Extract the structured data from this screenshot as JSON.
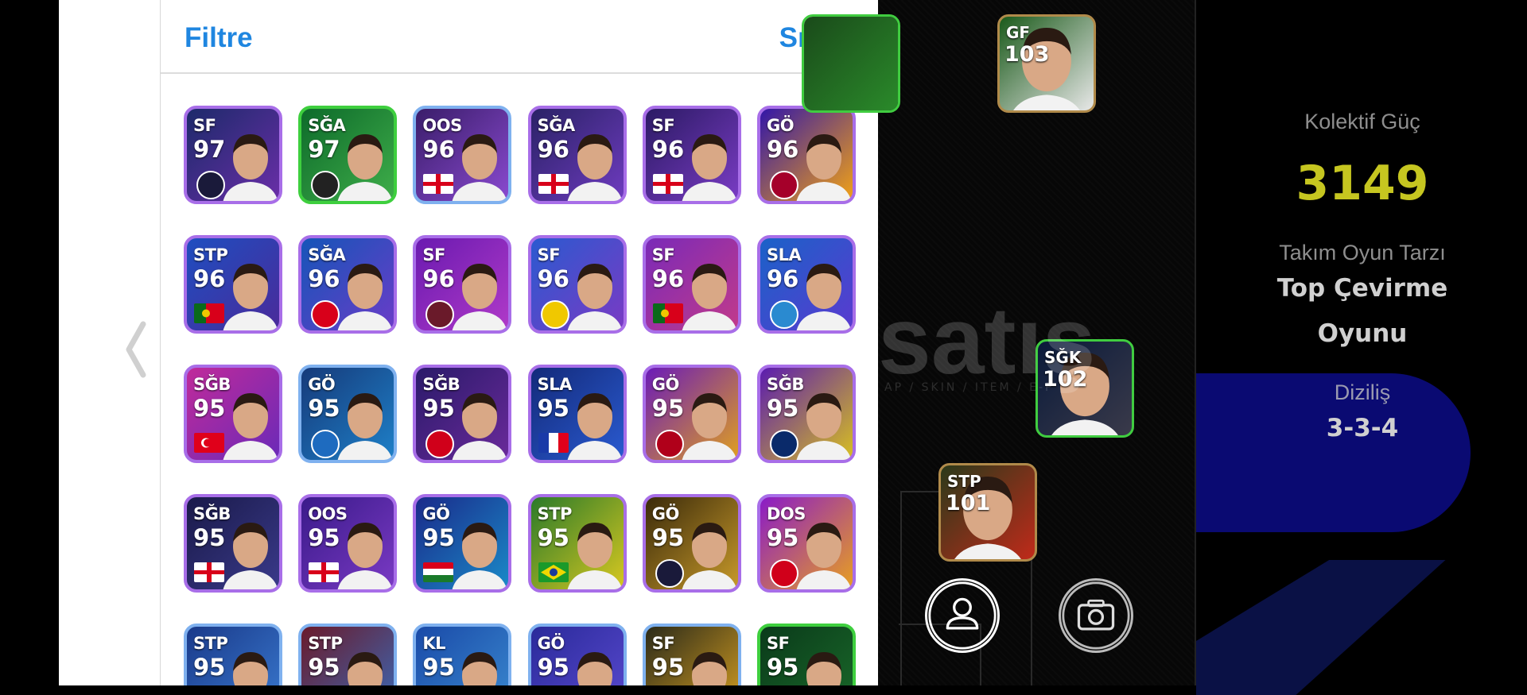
{
  "header": {
    "filter_label": "Filtre",
    "sort_label": "Sırala"
  },
  "colors": {
    "accent": "#1f86e0",
    "power": "#c6c620",
    "border_purple": "#a86ee8",
    "border_green": "#3ecf3e"
  },
  "players": [
    {
      "pos": "SF",
      "rating": "97",
      "mark": "badge",
      "badge_color": "#1a1a3a",
      "bg": [
        "#1c2a6a",
        "#6a2ea8"
      ],
      "border": "purple"
    },
    {
      "pos": "SĞA",
      "rating": "97",
      "mark": "badge",
      "badge_color": "#222",
      "bg": [
        "#0d6a2a",
        "#3fae4a"
      ],
      "border": "green"
    },
    {
      "pos": "OOS",
      "rating": "96",
      "mark": "flag",
      "flag": "eng",
      "bg": [
        "#3a1d6a",
        "#8a4ad0"
      ],
      "border": "blue"
    },
    {
      "pos": "SĞA",
      "rating": "96",
      "mark": "flag",
      "flag": "eng",
      "bg": [
        "#2a2266",
        "#6e3bbf"
      ],
      "border": "purple"
    },
    {
      "pos": "SF",
      "rating": "96",
      "mark": "flag",
      "flag": "eng",
      "bg": [
        "#2b1a64",
        "#7a3cc4"
      ],
      "border": "purple"
    },
    {
      "pos": "GÖ",
      "rating": "96",
      "mark": "badge",
      "badge_color": "#a5002a",
      "bg": [
        "#3216a8",
        "#f2a216"
      ],
      "border": "purple"
    },
    {
      "pos": "STP",
      "rating": "96",
      "mark": "flag",
      "flag": "por",
      "bg": [
        "#1e4ec0",
        "#4a2a9a"
      ],
      "border": "purple"
    },
    {
      "pos": "SĞA",
      "rating": "96",
      "mark": "badge",
      "badge_color": "#d8001a",
      "bg": [
        "#1555b8",
        "#6a3cc8"
      ],
      "border": "purple"
    },
    {
      "pos": "SF",
      "rating": "96",
      "mark": "badge",
      "badge_color": "#6a1a2a",
      "bg": [
        "#6a1ab0",
        "#b03ac8"
      ],
      "border": "purple"
    },
    {
      "pos": "SF",
      "rating": "96",
      "mark": "badge",
      "badge_color": "#f0c800",
      "bg": [
        "#2a5ad0",
        "#7a3ac4"
      ],
      "border": "purple"
    },
    {
      "pos": "SF",
      "rating": "96",
      "mark": "flag",
      "flag": "por",
      "bg": [
        "#7a2ab8",
        "#c23a8a"
      ],
      "border": "purple"
    },
    {
      "pos": "SLA",
      "rating": "96",
      "mark": "badge",
      "badge_color": "#2a8ad0",
      "bg": [
        "#1a62c8",
        "#5a3ad0"
      ],
      "border": "purple"
    },
    {
      "pos": "SĞB",
      "rating": "95",
      "mark": "flag",
      "flag": "tur",
      "bg": [
        "#c02a9a",
        "#6a2ab8"
      ],
      "border": "purple"
    },
    {
      "pos": "GÖ",
      "rating": "95",
      "mark": "badge",
      "badge_color": "#1e6bbf",
      "bg": [
        "#163a7a",
        "#1e80c8"
      ],
      "border": "blue"
    },
    {
      "pos": "SĞB",
      "rating": "95",
      "mark": "badge",
      "badge_color": "#d0001a",
      "bg": [
        "#2a1a6a",
        "#6a2a9a"
      ],
      "border": "purple"
    },
    {
      "pos": "SLA",
      "rating": "95",
      "mark": "flag",
      "flag": "fra",
      "bg": [
        "#132a7a",
        "#2a5ad0"
      ],
      "border": "purple"
    },
    {
      "pos": "GÖ",
      "rating": "95",
      "mark": "badge",
      "badge_color": "#b0001a",
      "bg": [
        "#6a1ab8",
        "#e0a020"
      ],
      "border": "purple"
    },
    {
      "pos": "SĞB",
      "rating": "95",
      "mark": "badge",
      "badge_color": "#0a2a6a",
      "bg": [
        "#5a1ab0",
        "#d8c020"
      ],
      "border": "purple"
    },
    {
      "pos": "SĞB",
      "rating": "95",
      "mark": "flag",
      "flag": "eng",
      "bg": [
        "#1a1a4a",
        "#3a3a8a"
      ],
      "border": "purple"
    },
    {
      "pos": "OOS",
      "rating": "95",
      "mark": "flag",
      "flag": "eng",
      "bg": [
        "#3a1a8a",
        "#7a3ac4"
      ],
      "border": "purple"
    },
    {
      "pos": "GÖ",
      "rating": "95",
      "mark": "flag",
      "flag": "hun",
      "bg": [
        "#1a2a8a",
        "#1a8ac8"
      ],
      "border": "purple"
    },
    {
      "pos": "STP",
      "rating": "95",
      "mark": "flag",
      "flag": "bra",
      "bg": [
        "#2a7a2a",
        "#d8c820"
      ],
      "border": "purple"
    },
    {
      "pos": "GÖ",
      "rating": "95",
      "mark": "badge",
      "badge_color": "#1a1a3a",
      "bg": [
        "#3a2a0a",
        "#c89a2a"
      ],
      "border": "purple"
    },
    {
      "pos": "DOS",
      "rating": "95",
      "mark": "badge",
      "badge_color": "#d0001a",
      "bg": [
        "#8a1ac8",
        "#e8a020"
      ],
      "border": "purple"
    },
    {
      "pos": "STP",
      "rating": "95",
      "mark": "none",
      "bg": [
        "#1a3a8a",
        "#3a7ad0"
      ],
      "border": "blue"
    },
    {
      "pos": "STP",
      "rating": "95",
      "mark": "none",
      "bg": [
        "#6a1a2a",
        "#3a6ab8"
      ],
      "border": "blue"
    },
    {
      "pos": "KL",
      "rating": "95",
      "mark": "none",
      "bg": [
        "#1a4aa8",
        "#3a8ad0"
      ],
      "border": "blue"
    },
    {
      "pos": "GÖ",
      "rating": "95",
      "mark": "none",
      "bg": [
        "#2a2a9a",
        "#5a4ad0"
      ],
      "border": "blue"
    },
    {
      "pos": "SF",
      "rating": "95",
      "mark": "none",
      "bg": [
        "#2a2a1a",
        "#d8a020"
      ],
      "border": "blue"
    },
    {
      "pos": "SF",
      "rating": "95",
      "mark": "none",
      "bg": [
        "#0a3a1a",
        "#1a6a2a"
      ],
      "border": "green"
    }
  ],
  "formation_cards": [
    {
      "pos": "GF",
      "rating": "103",
      "bg": [
        "#1a5a1a",
        "#e8e8e8"
      ],
      "border": "gold"
    },
    {
      "pos": "SĞK",
      "rating": "102",
      "bg": [
        "#0a1a3a",
        "#3a3a4a"
      ],
      "border": "green"
    },
    {
      "pos": "STP",
      "rating": "101",
      "bg": [
        "#2a3a1a",
        "#c02a1a"
      ],
      "border": "gold"
    }
  ],
  "info": {
    "collective_label": "Kolektif Güç",
    "collective_value": "3149",
    "style_label": "Takım Oyun Tarzı",
    "style_value_1": "Top Çevirme",
    "style_value_2": "Oyunu",
    "formation_label": "Diziliş",
    "formation_value": "3-3-4"
  },
  "watermark": {
    "text": "satış",
    "sub": "AP / SKIN / ITEM / E-P"
  },
  "icons": [
    "chevron-left-icon",
    "person-icon",
    "camera-icon"
  ]
}
